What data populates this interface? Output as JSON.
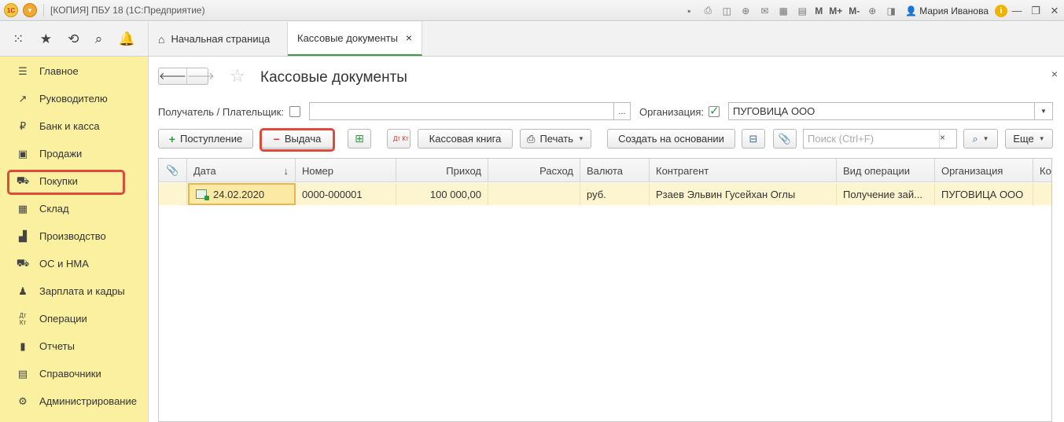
{
  "app": {
    "title": "[КОПИЯ] ПБУ 18  (1С:Предприятие)",
    "user": "Мария Иванова",
    "toolbar_text_buttons": [
      "M",
      "M+",
      "M-"
    ]
  },
  "tabs": [
    {
      "label": "Начальная страница"
    },
    {
      "label": "Кассовые документы",
      "close": "×"
    }
  ],
  "sidebar": {
    "items": [
      {
        "label": "Главное",
        "icon": "menu-icon"
      },
      {
        "label": "Руководителю",
        "icon": "chart-trend-icon"
      },
      {
        "label": "Банк и касса",
        "icon": "ruble-icon"
      },
      {
        "label": "Продажи",
        "icon": "shopping-bag-icon"
      },
      {
        "label": "Покупки",
        "icon": "cart-icon"
      },
      {
        "label": "Склад",
        "icon": "warehouse-icon"
      },
      {
        "label": "Производство",
        "icon": "factory-icon"
      },
      {
        "label": "ОС и НМА",
        "icon": "truck-icon"
      },
      {
        "label": "Зарплата и кадры",
        "icon": "person-icon"
      },
      {
        "label": "Операции",
        "icon": "dt-kt-icon"
      },
      {
        "label": "Отчеты",
        "icon": "bar-chart-icon"
      },
      {
        "label": "Справочники",
        "icon": "book-icon"
      },
      {
        "label": "Администрирование",
        "icon": "gear-icon"
      }
    ]
  },
  "page": {
    "title": "Кассовые документы",
    "close": "×"
  },
  "filters": {
    "payer_label": "Получатель / Плательщик:",
    "payer_value": "",
    "payer_button": "...",
    "org_label": "Организация:",
    "org_value": "ПУГОВИЦА ООО"
  },
  "toolbar": {
    "receipt": "Поступление",
    "issue": "Выдача",
    "dt_kt": "Дт Кт",
    "cash_book": "Кассовая книга",
    "print": "Печать",
    "create_based": "Создать на основании",
    "search_placeholder": "Поиск (Ctrl+F)",
    "more": "Еще"
  },
  "table": {
    "columns": [
      "Дата",
      "Номер",
      "Приход",
      "Расход",
      "Валюта",
      "Контрагент",
      "Вид операции",
      "Организация",
      "Ко"
    ],
    "sort_indicator": "↓",
    "rows": [
      {
        "date": "24.02.2020",
        "number": "0000-000001",
        "income": "100 000,00",
        "expense": "",
        "currency": "руб.",
        "counterparty": "Рзаев Эльвин Гусейхан Оглы",
        "operation": "Получение зай...",
        "organization": "ПУГОВИЦА ООО",
        "extra": ""
      }
    ]
  },
  "colors": {
    "sidebar_bg": "#fbf0a0",
    "highlight_red": "#e04a3a",
    "accent_green": "#3c9b4a",
    "selected_row": "#fdf5d0"
  }
}
